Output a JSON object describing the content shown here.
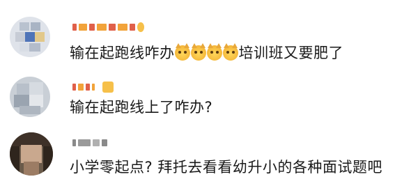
{
  "comments": [
    {
      "username": "",
      "text_before_emoji": "输在起跑线咋办",
      "emoji": [
        "doge-emoji",
        "doge-emoji",
        "doge-emoji",
        "doge-emoji"
      ],
      "text_after_emoji": "培训班又要肥了"
    },
    {
      "username": "",
      "text": "输在起跑线上了咋办?"
    },
    {
      "username": "",
      "text": "小学零起点? 拜托去看看幼升小的各种面试题吧"
    }
  ],
  "colors": {
    "text": "#1a1a1a",
    "background": "#ffffff",
    "blur_orange": "#f2a33a",
    "blur_red": "#e0604a",
    "blur_gray": "#8a8a8a"
  }
}
